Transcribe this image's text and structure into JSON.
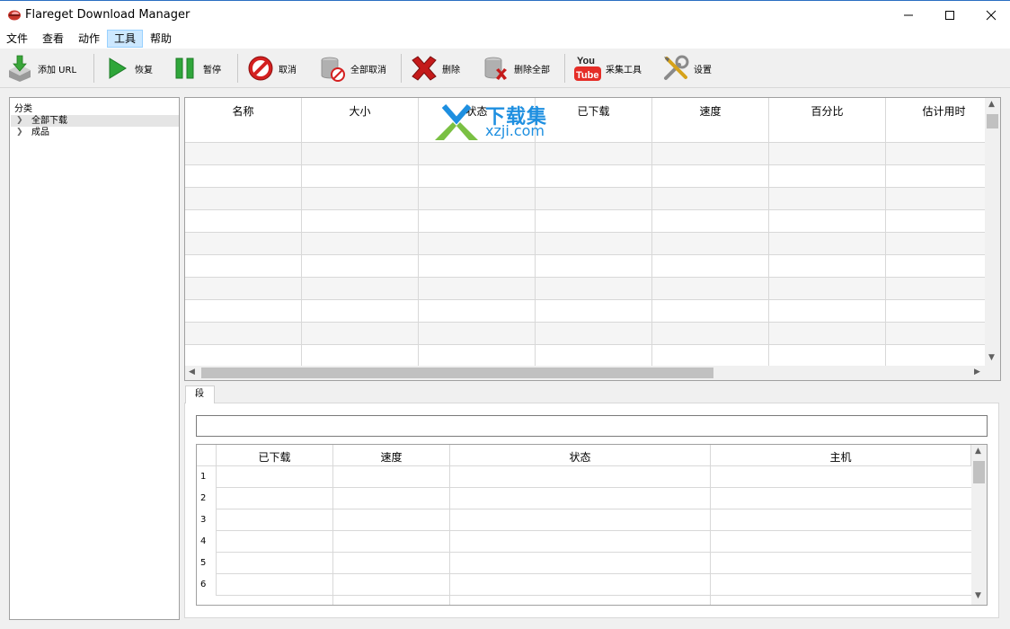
{
  "window": {
    "title": "Flareget Download Manager"
  },
  "menu": {
    "items": [
      {
        "label": "文件"
      },
      {
        "label": "查看"
      },
      {
        "label": "动作"
      },
      {
        "label": "工具"
      },
      {
        "label": "帮助"
      }
    ]
  },
  "toolbar": {
    "add_url": "添加 URL",
    "resume": "恢复",
    "pause": "暂停",
    "cancel": "取消",
    "cancel_all": "全部取消",
    "delete": "删除",
    "delete_all": "删除全部",
    "grabber": "采集工具",
    "settings": "设置",
    "youtube_top": "You",
    "youtube_bottom": "Tube"
  },
  "categories": {
    "title": "分类",
    "items": [
      {
        "label": "全部下载"
      },
      {
        "label": "成品"
      }
    ]
  },
  "downloads_table": {
    "columns": [
      "名称",
      "大小",
      "状态",
      "已下载",
      "速度",
      "百分比",
      "估计用时"
    ]
  },
  "watermark": {
    "cn": "下载集",
    "en": "xzji.com"
  },
  "segments": {
    "tab_label": "段",
    "input_value": "",
    "columns": [
      "已下载",
      "速度",
      "状态",
      "主机"
    ],
    "row_numbers": [
      "1",
      "2",
      "3",
      "4",
      "5",
      "6"
    ]
  },
  "colors": {
    "accent_blue": "#2b6fc2",
    "menu_active_bg": "#cce8ff",
    "resume_green": "#2fa63a",
    "cancel_red": "#d42020",
    "youtube_red": "#e52d27"
  }
}
